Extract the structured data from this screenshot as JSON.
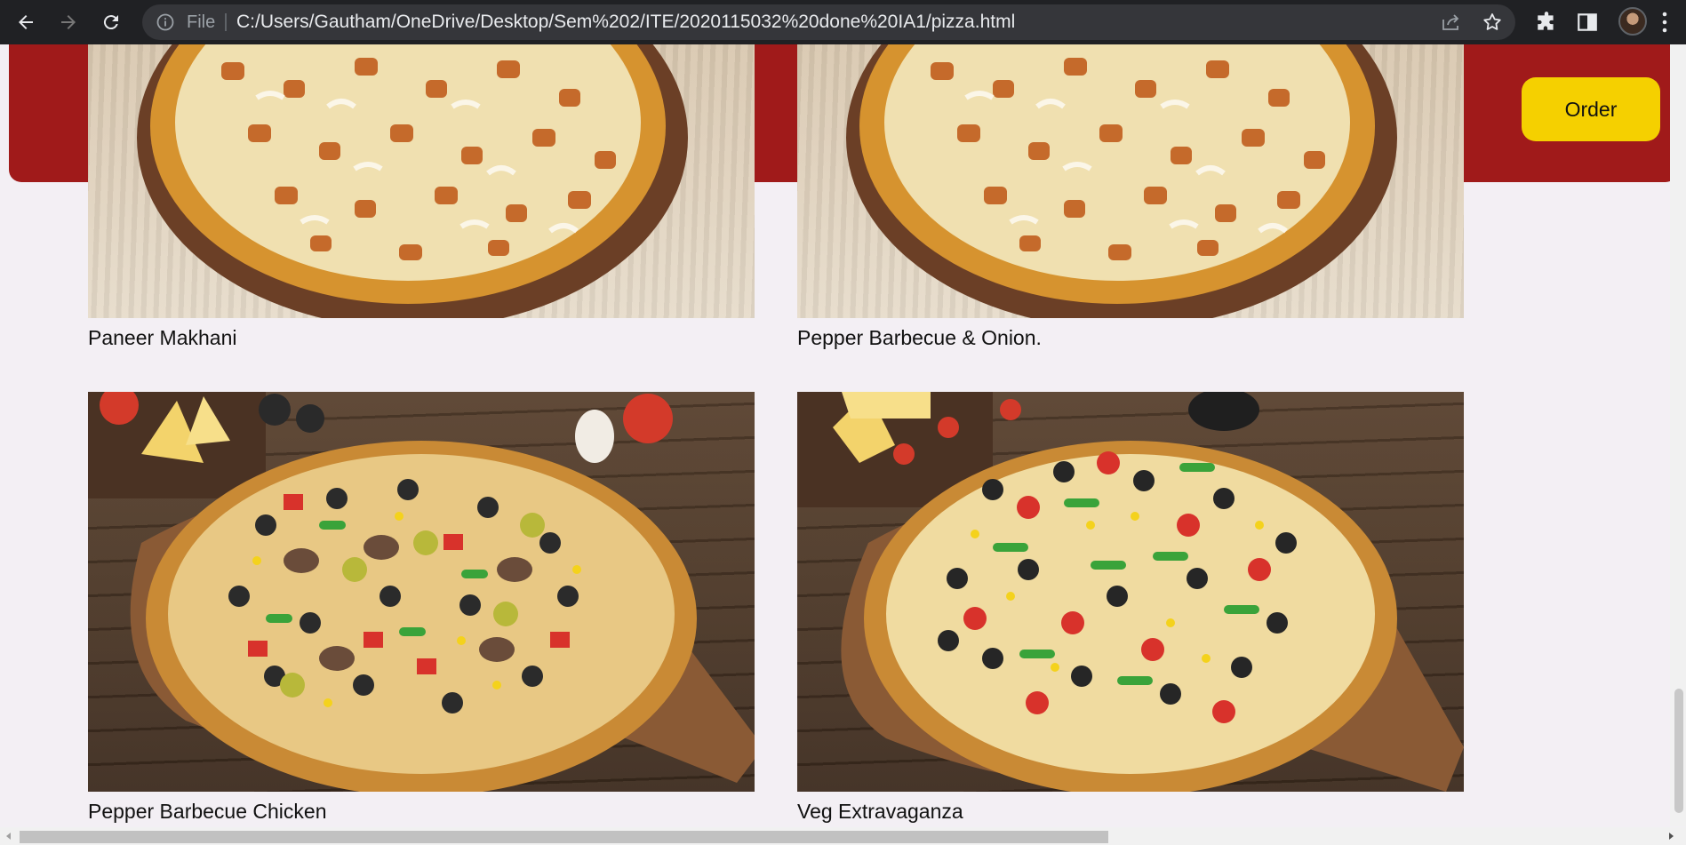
{
  "browser": {
    "file_label": "File",
    "url": "C:/Users/Gautham/OneDrive/Desktop/Sem%202/ITE/2020115032%20done%20IA1/pizza.html",
    "icons": [
      "back-icon",
      "forward-icon",
      "reload-icon",
      "info-icon",
      "share-icon",
      "star-icon",
      "puzzle-icon",
      "sidepanel-icon",
      "avatar",
      "menu-icon"
    ]
  },
  "header": {
    "order_label": "Order",
    "colors": {
      "bar": "#a01a1a",
      "button": "#f5d000"
    }
  },
  "pizzas": [
    {
      "name": "Paneer Makhani"
    },
    {
      "name": "Pepper Barbecue & Onion."
    },
    {
      "name": "Pepper Barbecue Chicken"
    },
    {
      "name": "Veg Extravaganza"
    }
  ]
}
